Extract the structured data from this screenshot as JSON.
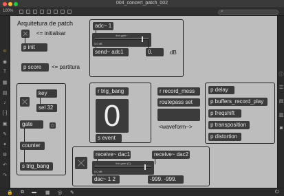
{
  "window": {
    "title": "004_concert_patch_002",
    "zoom": "100%",
    "traffic_colors": [
      "#ff5f57",
      "#febc2e",
      "#28c840"
    ]
  },
  "sidebar_left": {
    "icons": [
      "gear-icon",
      "circle-icon",
      "text-icon",
      "grid-icon",
      "music-note-icon",
      "bracket-icon",
      "image-icon",
      "hierarchy-icon",
      "star-icon",
      "link-icon",
      "undo-icon",
      "redo-icon"
    ]
  },
  "sidebar_right": {
    "icons": [
      "info-icon",
      "list-icon",
      "stack-icon",
      "camera-icon"
    ]
  },
  "panels": {
    "init": {
      "title": "Arquitetura de patch",
      "comment_init": "<= initialisar",
      "pinit": "p init"
    },
    "score": {
      "pscore": "p score",
      "comment": "<= partitura"
    },
    "counter": {
      "key": "key",
      "sel": "sel 32",
      "gate": "gate",
      "counter": "counter",
      "sender": "s trig_bang"
    },
    "adc": {
      "adc": "adc~ 1",
      "gain_label": "live.gain~",
      "gain_value": "0.0 dB",
      "send": "send~ adc1",
      "num": "0.",
      "unit": "dB"
    },
    "trig": {
      "recv": "r trig_bang",
      "bignum": "0",
      "send": "s event"
    },
    "record": {
      "recv": "r record_mess",
      "route": "routepass set",
      "wave_label": "<waveform~>"
    },
    "fx": {
      "items": [
        "p delay",
        "p buffers_record_play",
        "p freqshift",
        "p transposition",
        "p distortion"
      ]
    },
    "dac": {
      "recv1": "receive~ dac1",
      "recv2": "receive~ dac2",
      "gain_label": "live.gain~[1]",
      "gain_value": "0.0 dB",
      "dac": "dac~ 1 2",
      "msg": "-999. -999."
    }
  }
}
